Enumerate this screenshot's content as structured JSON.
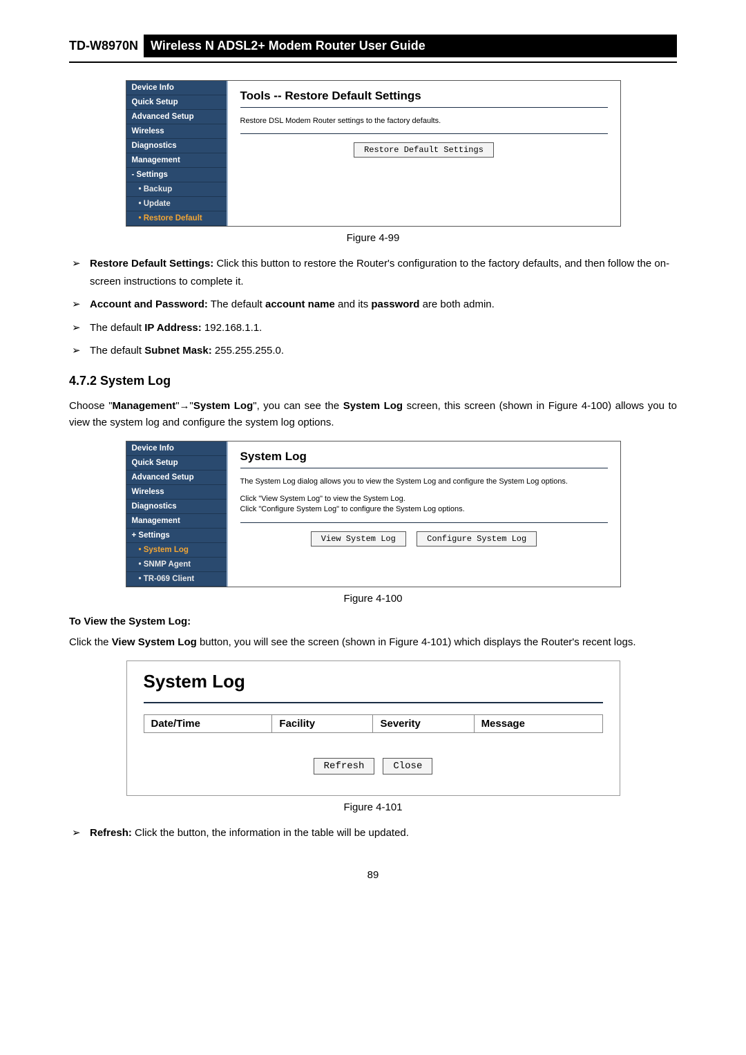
{
  "header": {
    "model": "TD-W8970N",
    "title": "Wireless N ADSL2+ Modem Router User Guide"
  },
  "fig99": {
    "caption": "Figure 4-99",
    "sidebar": {
      "device_info": "Device Info",
      "quick_setup": "Quick Setup",
      "advanced_setup": "Advanced Setup",
      "wireless": "Wireless",
      "diagnostics": "Diagnostics",
      "management": "Management",
      "settings": "Settings",
      "backup": "Backup",
      "update": "Update",
      "restore_default": "Restore Default"
    },
    "content": {
      "heading": "Tools -- Restore Default Settings",
      "desc": "Restore DSL Modem Router settings to the factory defaults.",
      "button": "Restore Default Settings"
    }
  },
  "bullets99": {
    "b1_label": "Restore Default Settings:",
    "b1_text": " Click this button to restore the Router's configuration to the factory defaults, and then follow the on-screen instructions to complete it.",
    "b2_label": "Account and Password:",
    "b2_mid1": " The default ",
    "b2_bold1": "account name",
    "b2_mid2": " and its ",
    "b2_bold2": "password",
    "b2_tail": " are both admin.",
    "b3_prefix": "The default ",
    "b3_bold": "IP Address:",
    "b3_tail": " 192.168.1.1.",
    "b4_prefix": "The default ",
    "b4_bold": "Subnet Mask:",
    "b4_tail": " 255.255.255.0."
  },
  "section472": {
    "heading": "4.7.2   System Log",
    "p1a": "Choose  \"",
    "p1b": "Management",
    "p1c": "\"→\"",
    "p1d": "System Log",
    "p1e": "\",  you  can  see  the  ",
    "p1f": "System Log",
    "p1g": "  screen,  this  screen (shown in Figure 4-100) allows you to view the system log and configure the system log options."
  },
  "fig100": {
    "caption": "Figure 4-100",
    "sidebar": {
      "device_info": "Device Info",
      "quick_setup": "Quick Setup",
      "advanced_setup": "Advanced Setup",
      "wireless": "Wireless",
      "diagnostics": "Diagnostics",
      "management": "Management",
      "settings": "Settings",
      "system_log": "System Log",
      "snmp_agent": "SNMP Agent",
      "tr069": "TR-069 Client"
    },
    "content": {
      "heading": "System Log",
      "desc1": "The System Log dialog allows you to view the System Log and configure the System Log options.",
      "desc2": "Click \"View System Log\" to view the System Log.",
      "desc3": "Click \"Configure System Log\" to configure the System Log options.",
      "button1": "View System Log",
      "button2": "Configure System Log"
    }
  },
  "viewlog": {
    "subhead": "To View the System Log:",
    "p1a": "Click the ",
    "p1b": "View System Log",
    "p1c": " button, you will see the screen (shown in Figure 4-101) which displays the Router's recent logs."
  },
  "fig101": {
    "heading": "System Log",
    "cols": {
      "c1": "Date/Time",
      "c2": "Facility",
      "c3": "Severity",
      "c4": "Message"
    },
    "btn1": "Refresh",
    "btn2": "Close",
    "caption": "Figure 4-101"
  },
  "bullets101": {
    "b1_label": "Refresh:",
    "b1_text": " Click the button, the information in the table will be updated."
  },
  "page_number": "89"
}
